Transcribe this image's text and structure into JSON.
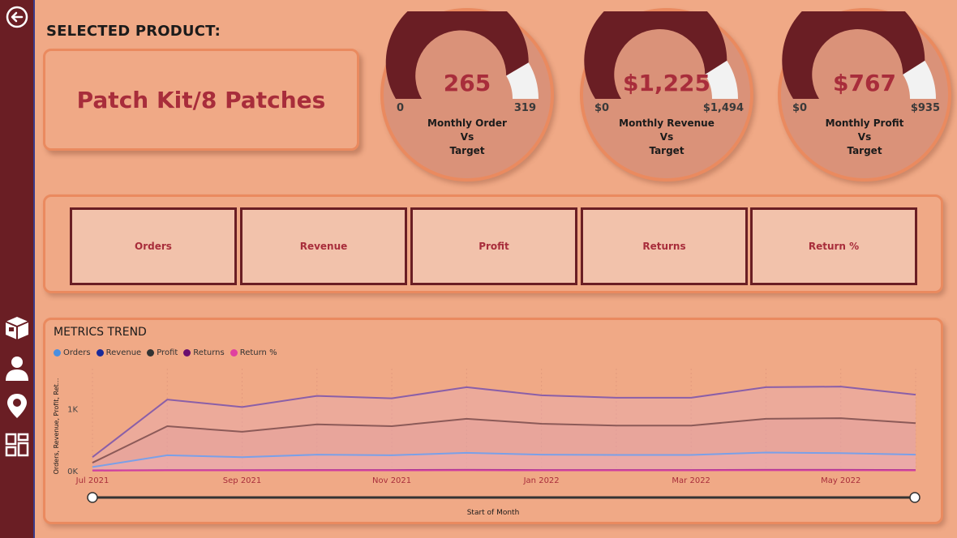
{
  "sidebar": {
    "items": [
      {
        "name": "back-arrow-icon"
      },
      {
        "name": "product-box-icon"
      },
      {
        "name": "customer-person-icon"
      },
      {
        "name": "map-pin-icon"
      },
      {
        "name": "dashboard-grid-icon"
      }
    ]
  },
  "header": {
    "selected_label": "SELECTED PRODUCT:"
  },
  "product": {
    "name": "Patch Kit/8 Patches"
  },
  "gauges": [
    {
      "value": "265",
      "min": "0",
      "max": "319",
      "title1": "Monthly Order",
      "title2": "Vs",
      "title3": "Target",
      "fraction": 0.83
    },
    {
      "value": "$1,225",
      "min": "$0",
      "max": "$1,494",
      "title1": "Monthly Revenue",
      "title2": "Vs",
      "title3": "Target",
      "fraction": 0.82
    },
    {
      "value": "$767",
      "min": "$0",
      "max": "$935",
      "title1": "Monthly Profit",
      "title2": "Vs",
      "title3": "Target",
      "fraction": 0.82
    }
  ],
  "metric_buttons": [
    "Orders",
    "Revenue",
    "Profit",
    "Returns",
    "Return %"
  ],
  "trend": {
    "title": "METRICS TREND",
    "x_axis_title": "Start of Month",
    "y_axis_title": "Orders, Revenue, Profit, Ret..."
  },
  "colors": {
    "accent": "#6A1E24",
    "text_red": "#A82D3B",
    "background": "#F0A986",
    "orders": "#4A8FE0",
    "revenue": "#1A2A9A",
    "profit": "#333333",
    "returns": "#6B0F6F",
    "return_pct": "#E040A0"
  },
  "chart_data": {
    "type": "area",
    "x": [
      "Jul 2021",
      "Aug 2021",
      "Sep 2021",
      "Oct 2021",
      "Nov 2021",
      "Dec 2021",
      "Jan 2022",
      "Feb 2022",
      "Mar 2022",
      "Apr 2022",
      "May 2022",
      "Jun 2022"
    ],
    "tick_labels": [
      "Jul 2021",
      "Sep 2021",
      "Nov 2021",
      "Jan 2022",
      "Mar 2022",
      "May 2022"
    ],
    "y_ticks": [
      "0K",
      "1K"
    ],
    "ylim": [
      0,
      1650
    ],
    "legend": "top-left",
    "series": [
      {
        "name": "Orders",
        "values": [
          60,
          250,
          220,
          260,
          250,
          290,
          260,
          255,
          255,
          295,
          285,
          260
        ]
      },
      {
        "name": "Revenue",
        "values": [
          220,
          1150,
          1030,
          1210,
          1170,
          1350,
          1220,
          1180,
          1180,
          1350,
          1360,
          1230
        ]
      },
      {
        "name": "Profit",
        "values": [
          130,
          720,
          630,
          750,
          720,
          840,
          760,
          730,
          730,
          840,
          850,
          770
        ]
      },
      {
        "name": "Returns",
        "values": [
          5,
          10,
          10,
          12,
          12,
          14,
          12,
          12,
          12,
          14,
          14,
          12
        ]
      },
      {
        "name": "Return %",
        "values": [
          3,
          6,
          6,
          7,
          7,
          8,
          7,
          7,
          7,
          8,
          8,
          7
        ]
      }
    ]
  }
}
